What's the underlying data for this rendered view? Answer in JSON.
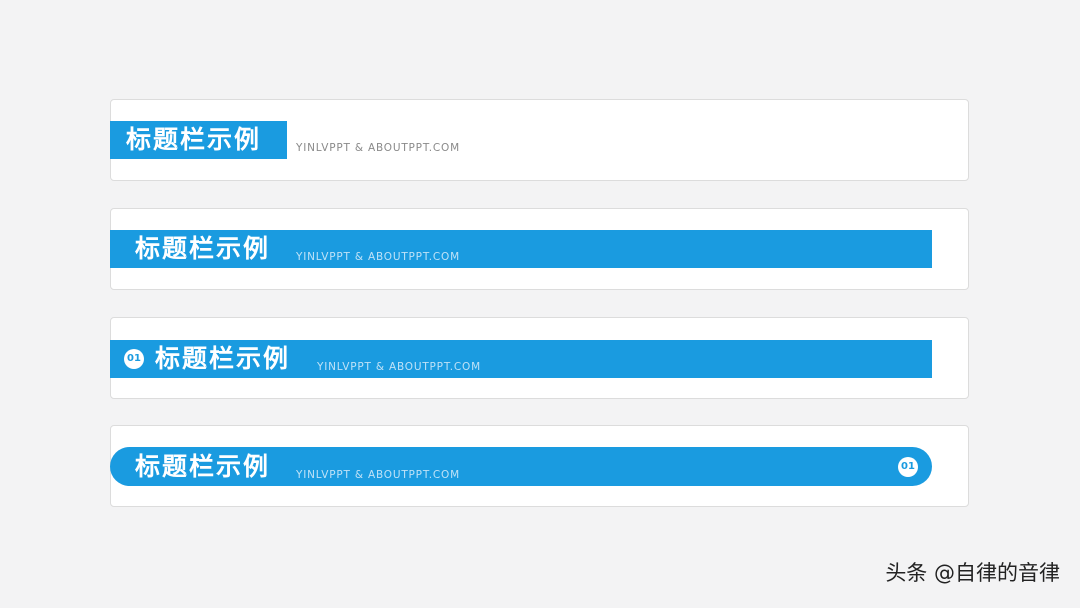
{
  "examples": [
    {
      "title": "标题栏示例",
      "subtitle": "YINLVPPT  &  ABOUTPPT.COM"
    },
    {
      "title": "标题栏示例",
      "subtitle": "YINLVPPT  &  ABOUTPPT.COM"
    },
    {
      "title": "标题栏示例",
      "subtitle": "YINLVPPT  &  ABOUTPPT.COM",
      "badge": "01"
    },
    {
      "title": "标题栏示例",
      "subtitle": "YINLVPPT  &  ABOUTPPT.COM",
      "badge": "01"
    }
  ],
  "watermark": "头条 @自律的音律",
  "colors": {
    "accent": "#1a9be0",
    "background": "#f3f3f4",
    "card": "#ffffff"
  }
}
